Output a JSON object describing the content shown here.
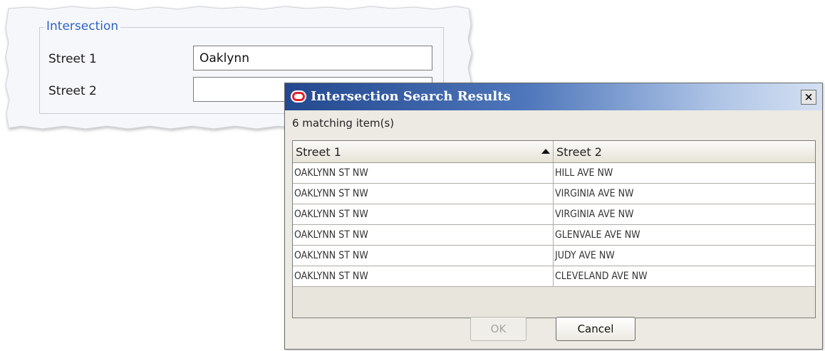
{
  "form": {
    "group_title": "Intersection",
    "street1_label": "Street 1",
    "street1_value": "Oaklynn",
    "street2_label": "Street 2",
    "street2_value": ""
  },
  "dialog": {
    "title": "Intersection Search Results",
    "close_label": "×",
    "match_count": "6 matching item(s)",
    "columns": [
      "Street 1",
      "Street 2"
    ],
    "sort": {
      "column": "Street 1",
      "direction": "ascending"
    },
    "rows": [
      [
        "OAKLYNN ST NW",
        "HILL AVE NW"
      ],
      [
        "OAKLYNN ST NW",
        "VIRGINIA AVE NW"
      ],
      [
        "OAKLYNN ST NW",
        "VIRGINIA AVE NW"
      ],
      [
        "OAKLYNN ST NW",
        "GLENVALE AVE NW"
      ],
      [
        "OAKLYNN ST NW",
        "JUDY AVE NW"
      ],
      [
        "OAKLYNN ST NW",
        "CLEVELAND AVE NW"
      ]
    ],
    "ok_label": "OK",
    "ok_enabled": false,
    "cancel_label": "Cancel"
  },
  "colors": {
    "legend_text": "#2f63c4",
    "titlebar_start": "#23488f",
    "oracle_red": "#e4202a",
    "dialog_bg": "#edeae3"
  },
  "icons": {
    "dialog_icon": "oracle-logo-icon",
    "close": "close-icon",
    "sort": "sort-ascending-icon"
  }
}
